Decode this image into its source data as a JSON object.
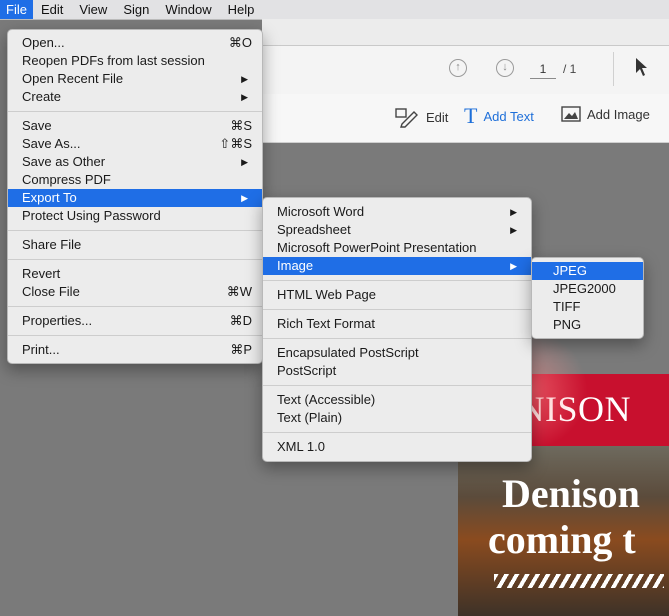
{
  "menubar": {
    "items": [
      {
        "label": "File",
        "active": true
      },
      {
        "label": "Edit"
      },
      {
        "label": "View"
      },
      {
        "label": "Sign"
      },
      {
        "label": "Window"
      },
      {
        "label": "Help"
      }
    ]
  },
  "toolbar": {
    "page_current": "1",
    "page_total": "/ 1",
    "edit_label": "Edit",
    "add_text_label": "Add Text",
    "add_image_label": "Add Image"
  },
  "file_menu": {
    "open": {
      "label": "Open...",
      "shortcut": "⌘O"
    },
    "reopen": {
      "label": "Reopen PDFs from last session"
    },
    "open_recent": {
      "label": "Open Recent File"
    },
    "create": {
      "label": "Create"
    },
    "save": {
      "label": "Save",
      "shortcut": "⌘S"
    },
    "save_as": {
      "label": "Save As...",
      "shortcut": "⇧⌘S"
    },
    "save_as_other": {
      "label": "Save as Other"
    },
    "compress": {
      "label": "Compress PDF"
    },
    "export_to": {
      "label": "Export To"
    },
    "protect": {
      "label": "Protect Using Password"
    },
    "share": {
      "label": "Share File"
    },
    "revert": {
      "label": "Revert"
    },
    "close": {
      "label": "Close File",
      "shortcut": "⌘W"
    },
    "properties": {
      "label": "Properties...",
      "shortcut": "⌘D"
    },
    "print": {
      "label": "Print...",
      "shortcut": "⌘P"
    }
  },
  "export_menu": {
    "word": "Microsoft Word",
    "spreadsheet": "Spreadsheet",
    "powerpoint": "Microsoft PowerPoint Presentation",
    "image": "Image",
    "html": "HTML Web Page",
    "rtf": "Rich Text Format",
    "eps": "Encapsulated PostScript",
    "ps": "PostScript",
    "text_accessible": "Text (Accessible)",
    "text_plain": "Text (Plain)",
    "xml": "XML 1.0"
  },
  "image_menu": {
    "jpeg": "JPEG",
    "jpeg2000": "JPEG2000",
    "tiff": "TIFF",
    "png": "PNG"
  },
  "document": {
    "banner": "ENISON",
    "title_line1": "Denison",
    "title_line2": "coming t"
  },
  "colors": {
    "selection": "#1f6ee6",
    "accent_blue": "#1e6fd9",
    "banner_red": "#c8102e"
  },
  "arrow_glyph": "▶"
}
